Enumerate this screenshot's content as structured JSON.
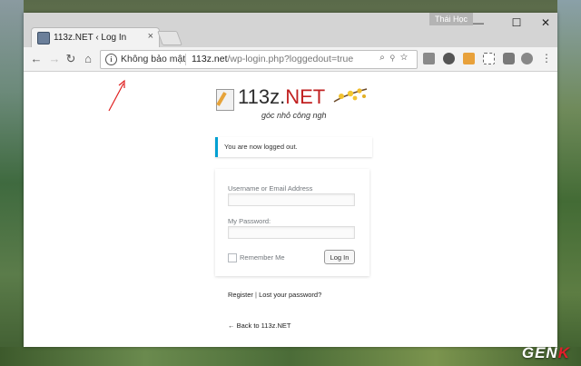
{
  "browser": {
    "tab": {
      "title": "113z.NET ‹ Log In",
      "close_glyph": "×"
    },
    "user_badge": "Thái Học",
    "window_controls": {
      "minimize": "—",
      "maximize": "☐",
      "close": "✕"
    },
    "nav": {
      "back": "←",
      "forward": "→",
      "reload": "↻",
      "home": "⌂"
    },
    "omnibox": {
      "security_label": "Không bảo mật",
      "url_domain": "113z.net",
      "url_path": "/wp-login.php?loggedout=true"
    }
  },
  "page": {
    "logo": {
      "name_main": "113z.",
      "name_accent": "NET",
      "tagline": "góc nhỏ công ngh"
    },
    "notice": "You are now logged out.",
    "form": {
      "username_label": "Username or Email Address",
      "username_value": "",
      "password_label": "My Password:",
      "password_value": "",
      "remember_label": "Remember Me",
      "submit_label": "Log In"
    },
    "links": {
      "register": "Register",
      "separator": " | ",
      "lost_password": "Lost your password?",
      "back_to_site": "← Back to 113z.NET"
    }
  },
  "watermark": {
    "part1": "GEN",
    "part2": "K"
  },
  "colors": {
    "notice_accent": "#00a0d2",
    "logo_accent": "#c12121",
    "annotation": "#e02020"
  }
}
